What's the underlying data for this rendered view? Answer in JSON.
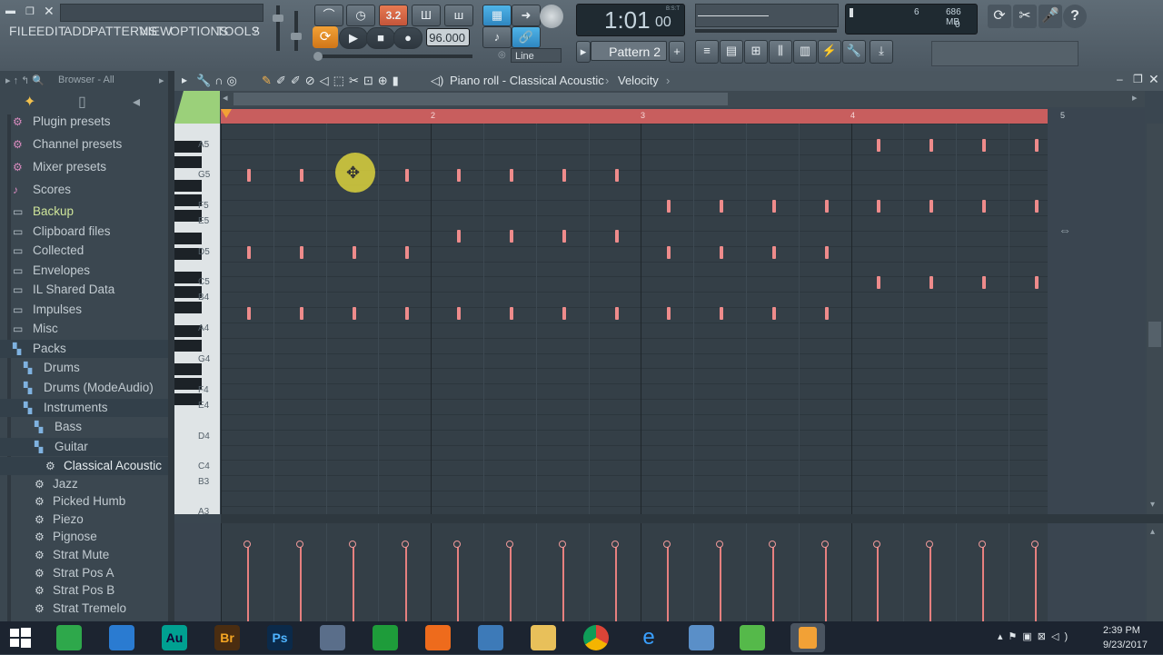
{
  "menu": [
    "FILE",
    "EDIT",
    "ADD",
    "PATTERNS",
    "VIEW",
    "OPTIONS",
    "TOOLS",
    "?"
  ],
  "transport": {
    "tempo": "96.000",
    "time": "1:01",
    "time_sub": "00",
    "time_unit": "B:S:T",
    "pattern": "Pattern 2",
    "snap": "Line",
    "cpu": "6",
    "mem": "686 MB",
    "voices": "0",
    "bpm_display": "3.2"
  },
  "browser": {
    "title": "Browser - All",
    "items": [
      {
        "label": "Plugin presets",
        "icon": "plugin-icon"
      },
      {
        "label": "Channel presets",
        "icon": "channel-icon"
      },
      {
        "label": "Mixer presets",
        "icon": "mixer-icon"
      },
      {
        "label": "Scores",
        "icon": "note-icon"
      },
      {
        "label": "Backup",
        "icon": "folder-icon"
      },
      {
        "label": "Clipboard files",
        "icon": "folder-icon"
      },
      {
        "label": "Collected",
        "icon": "folder-icon"
      },
      {
        "label": "Envelopes",
        "icon": "folder-icon"
      },
      {
        "label": "IL Shared Data",
        "icon": "folder-icon"
      },
      {
        "label": "Impulses",
        "icon": "folder-icon"
      },
      {
        "label": "Misc",
        "icon": "folder-icon"
      },
      {
        "label": "Packs",
        "icon": "pack-icon"
      },
      {
        "label": "Drums",
        "icon": "pack-icon"
      },
      {
        "label": "Drums (ModeAudio)",
        "icon": "pack-icon"
      },
      {
        "label": "Instruments",
        "icon": "pack-icon"
      },
      {
        "label": "Bass",
        "icon": "pack-icon"
      },
      {
        "label": "Guitar",
        "icon": "pack-icon"
      },
      {
        "label": "Classical Acoustic",
        "icon": "gear-icon"
      },
      {
        "label": "Jazz",
        "icon": "gear-icon"
      },
      {
        "label": "Picked Humb",
        "icon": "gear-icon"
      },
      {
        "label": "Piezo",
        "icon": "gear-icon"
      },
      {
        "label": "Pignose",
        "icon": "gear-icon"
      },
      {
        "label": "Strat Mute",
        "icon": "gear-icon"
      },
      {
        "label": "Strat Pos A",
        "icon": "gear-icon"
      },
      {
        "label": "Strat Pos B",
        "icon": "gear-icon"
      },
      {
        "label": "Strat Tremelo",
        "icon": "gear-icon"
      }
    ]
  },
  "piano_roll": {
    "title": "Piano roll - Classical Acoustic",
    "target": "Velocity",
    "bars": [
      "2",
      "3",
      "4",
      "5"
    ],
    "keys": [
      "A5",
      "G5",
      "F5",
      "E5",
      "D5",
      "C5",
      "B4",
      "A4",
      "G4",
      "F4",
      "E4",
      "D4",
      "C4",
      "B3",
      "A3"
    ]
  },
  "clock": {
    "time": "2:39 PM",
    "date": "9/23/2017"
  },
  "colors": {
    "note": "#ee8b8b",
    "ruler": "#c85e5e",
    "grid": "#343f47"
  }
}
